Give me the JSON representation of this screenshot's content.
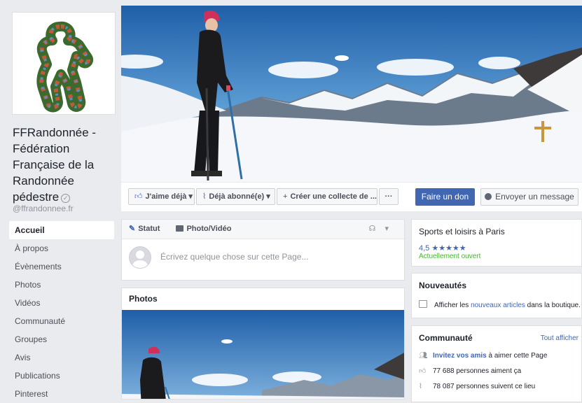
{
  "page": {
    "name": "FFRandonnée - Fédération Française de la Randonnée pédestre",
    "handle": "@ffrandonnee.fr"
  },
  "nav": [
    {
      "label": "Accueil",
      "active": true
    },
    {
      "label": "À propos"
    },
    {
      "label": "Évènements"
    },
    {
      "label": "Photos"
    },
    {
      "label": "Vidéos"
    },
    {
      "label": "Communauté"
    },
    {
      "label": "Groupes"
    },
    {
      "label": "Avis"
    },
    {
      "label": "Publications"
    },
    {
      "label": "Pinterest"
    }
  ],
  "actions": {
    "like": "J'aime déjà",
    "follow": "Déjà abonné(e)",
    "fundraiser": "Créer une collecte de ...",
    "more": "···",
    "donate": "Faire un don",
    "message": "Envoyer un message"
  },
  "composer": {
    "status_tab": "Statut",
    "media_tab": "Photo/Vidéo",
    "placeholder": "Écrivez quelque chose sur cette Page..."
  },
  "photos": {
    "title": "Photos"
  },
  "info": {
    "category": "Sports et loisirs à Paris",
    "rating": "4,5 ★★★★★",
    "status": "Actuellement ouvert"
  },
  "news": {
    "title": "Nouveautés",
    "text_before": "Afficher les ",
    "link": "nouveaux articles",
    "text_after": " dans la boutique."
  },
  "community": {
    "title": "Communauté",
    "see_all": "Tout afficher",
    "invite_link": "Invitez vos amis",
    "invite_rest": " à aimer cette Page",
    "likes": "77 688 personnes aiment ça",
    "followers": "78 087 personnes suivent ce lieu"
  },
  "colors": {
    "brand": "#4267b2",
    "background": "#e9ebee",
    "open_green": "#42b72a"
  }
}
